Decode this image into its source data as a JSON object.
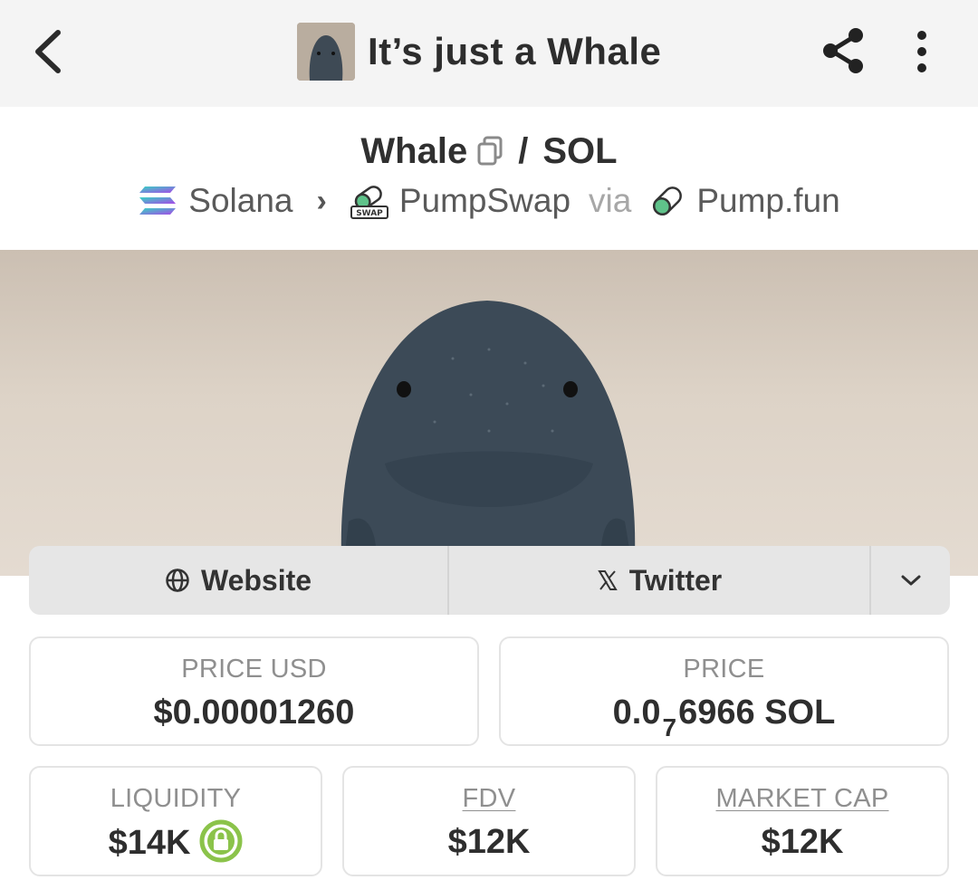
{
  "header": {
    "title": "It’s just a Whale"
  },
  "pair": {
    "base": "Whale",
    "separator": "/",
    "quote": "SOL"
  },
  "route": {
    "chain": "Solana",
    "dex": "PumpSwap",
    "dex_badge": "SWAP",
    "via_label": "via",
    "launchpad": "Pump.fun"
  },
  "links": {
    "website": "Website",
    "twitter": "Twitter"
  },
  "stats": {
    "price_usd": {
      "label": "PRICE USD",
      "value": "$0.00001260"
    },
    "price": {
      "label": "PRICE",
      "prefix": "0.0",
      "zeros": "7",
      "digits": "6966",
      "unit": "SOL"
    },
    "liquidity": {
      "label": "LIQUIDITY",
      "value": "$14K"
    },
    "fdv": {
      "label": "FDV",
      "value": "$12K"
    },
    "market_cap": {
      "label": "MARKET CAP",
      "value": "$12K"
    }
  },
  "colors": {
    "topbar_bg": "#f4f4f4",
    "link_bar_bg": "#e6e6e6",
    "lock_green": "#8bc34a"
  },
  "icons": [
    "back-icon",
    "share-icon",
    "more-vertical-icon",
    "copy-icon",
    "solana-icon",
    "pumpswap-icon",
    "pill-icon",
    "globe-icon",
    "x-logo-icon",
    "chevron-down-icon",
    "lock-icon"
  ]
}
